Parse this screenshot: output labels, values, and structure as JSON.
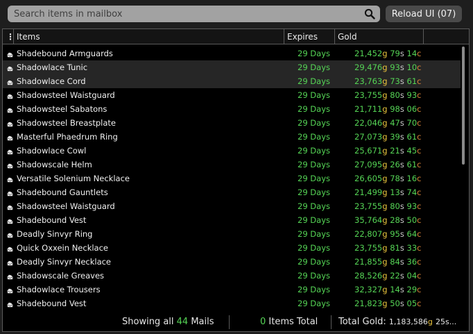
{
  "search": {
    "placeholder": "Search items in mailbox"
  },
  "reload_button": "Reload UI (07)",
  "columns": {
    "menu": "⋮",
    "items": "Items",
    "expires": "Expires",
    "gold": "Gold"
  },
  "rows": [
    {
      "name": "Shadebound Armguards",
      "expires": "29 Days",
      "g": "21,452",
      "s": "79",
      "c": "14"
    },
    {
      "name": "Shadowlace Tunic",
      "expires": "29 Days",
      "g": "29,476",
      "s": "93",
      "c": "10"
    },
    {
      "name": "Shadowlace Cord",
      "expires": "29 Days",
      "g": "23,763",
      "s": "73",
      "c": "61"
    },
    {
      "name": "Shadowsteel Waistguard",
      "expires": "29 Days",
      "g": "23,755",
      "s": "80",
      "c": "93"
    },
    {
      "name": "Shadowsteel Sabatons",
      "expires": "29 Days",
      "g": "21,711",
      "s": "98",
      "c": "06"
    },
    {
      "name": "Shadowsteel Breastplate",
      "expires": "29 Days",
      "g": "22,046",
      "s": "47",
      "c": "70"
    },
    {
      "name": "Masterful Phaedrum Ring",
      "expires": "29 Days",
      "g": "27,073",
      "s": "39",
      "c": "61"
    },
    {
      "name": "Shadowlace Cowl",
      "expires": "29 Days",
      "g": "25,671",
      "s": "21",
      "c": "45"
    },
    {
      "name": "Shadowscale Helm",
      "expires": "29 Days",
      "g": "27,095",
      "s": "26",
      "c": "61"
    },
    {
      "name": "Versatile Solenium Necklace",
      "expires": "29 Days",
      "g": "26,605",
      "s": "78",
      "c": "16"
    },
    {
      "name": "Shadebound Gauntlets",
      "expires": "29 Days",
      "g": "21,499",
      "s": "13",
      "c": "74"
    },
    {
      "name": "Shadowsteel Waistguard",
      "expires": "29 Days",
      "g": "23,755",
      "s": "80",
      "c": "93"
    },
    {
      "name": "Shadebound Vest",
      "expires": "29 Days",
      "g": "35,764",
      "s": "28",
      "c": "50"
    },
    {
      "name": "Deadly Sinvyr Ring",
      "expires": "29 Days",
      "g": "22,807",
      "s": "95",
      "c": "64"
    },
    {
      "name": "Quick Oxxein Necklace",
      "expires": "29 Days",
      "g": "23,755",
      "s": "81",
      "c": "33"
    },
    {
      "name": "Deadly Sinvyr Necklace",
      "expires": "29 Days",
      "g": "21,855",
      "s": "84",
      "c": "36"
    },
    {
      "name": "Shadowscale Greaves",
      "expires": "29 Days",
      "g": "28,526",
      "s": "22",
      "c": "04"
    },
    {
      "name": "Shadowlace Trousers",
      "expires": "29 Days",
      "g": "32,327",
      "s": "14",
      "c": "29"
    },
    {
      "name": "Shadebound Vest",
      "expires": "29 Days",
      "g": "21,823",
      "s": "50",
      "c": "05"
    }
  ],
  "units": {
    "gold": "g",
    "silver": "s",
    "copper": "c"
  },
  "highlighted_rows": [
    1,
    2
  ],
  "footer": {
    "showing_prefix": "Showing all",
    "mail_count": "44",
    "showing_suffix": "Mails",
    "items_count": "0",
    "items_label": "Items Total",
    "total_label": "Total Gold:",
    "total_value": "1,183,586",
    "total_rest": "25s..."
  },
  "colors": {
    "green": "#55d455",
    "gold": "#e8c23c",
    "silver": "#c9c9c9",
    "copper": "#d9833a"
  }
}
